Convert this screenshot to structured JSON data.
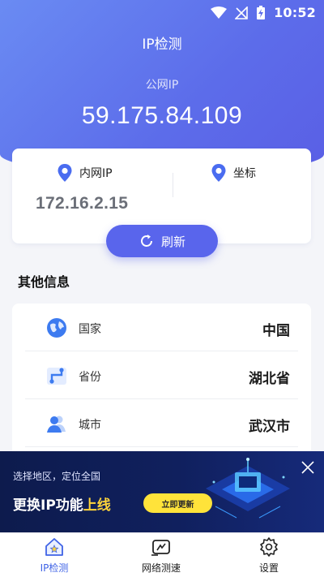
{
  "status_bar": {
    "time": "10:52"
  },
  "header": {
    "title": "IP检测",
    "public_ip_label": "公网IP",
    "public_ip": "59.175.84.109"
  },
  "ip_card": {
    "private_ip_label": "内网IP",
    "private_ip": "172.16.2.15",
    "coords_label": "坐标",
    "refresh_label": "刷新"
  },
  "other_info": {
    "title": "其他信息",
    "rows": [
      {
        "label": "国家",
        "value": "中国",
        "icon": "globe-icon"
      },
      {
        "label": "省份",
        "value": "湖北省",
        "icon": "map-route-icon"
      },
      {
        "label": "城市",
        "value": "武汉市",
        "icon": "people-icon"
      }
    ]
  },
  "banner": {
    "subtitle": "选择地区，定位全国",
    "headline_prefix": "更换IP功能",
    "headline_highlight": "上线",
    "cta_label": "立即更新"
  },
  "tabbar": {
    "tabs": [
      {
        "label": "IP检测",
        "icon": "home-icon",
        "active": true
      },
      {
        "label": "网络测速",
        "icon": "speedometer-icon",
        "active": false
      },
      {
        "label": "设置",
        "icon": "gear-icon",
        "active": false
      }
    ]
  },
  "colors": {
    "accent": "#5965ec",
    "active_tab": "#3f63e6",
    "cta_yellow": "#ffe33a",
    "banner_bg": "#10205e"
  }
}
